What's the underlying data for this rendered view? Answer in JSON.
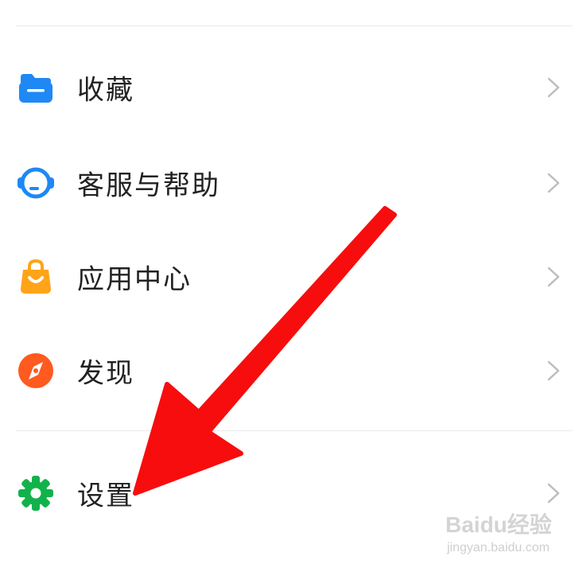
{
  "menu": {
    "items": [
      {
        "label": "收藏",
        "icon": "folder-icon",
        "color": "#1e88f5"
      },
      {
        "label": "客服与帮助",
        "icon": "headset-icon",
        "color": "#1e88f5"
      },
      {
        "label": "应用中心",
        "icon": "shopping-bag-icon",
        "color": "#ffa418"
      },
      {
        "label": "发现",
        "icon": "compass-icon",
        "color": "#ff5a1f"
      },
      {
        "label": "设置",
        "icon": "gear-icon",
        "color": "#12b24b"
      }
    ],
    "chevron_icon": "chevron-right-icon"
  },
  "annotation": {
    "type": "arrow",
    "color": "#f70d0d",
    "points_to": "设置"
  },
  "watermark": {
    "brand": "Baidu经验",
    "url": "jingyan.baidu.com"
  }
}
